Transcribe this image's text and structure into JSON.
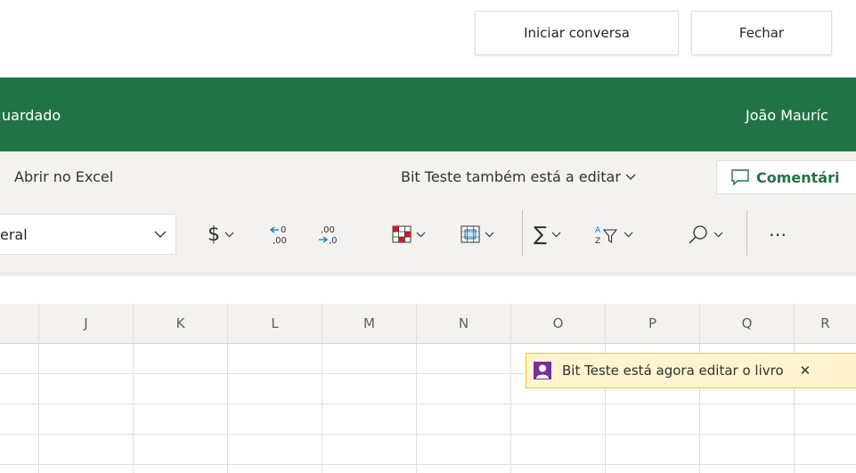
{
  "top_buttons": {
    "start": "Iniciar conversa",
    "close": "Fechar"
  },
  "titlebar": {
    "doc_status": "uardado",
    "user": "João Mauríc"
  },
  "ribbon": {
    "open_in_excel": "Abrir no Excel",
    "coauthor_status": "Bit Teste também está a editar",
    "comments": "Comentári"
  },
  "number_format": {
    "value": "eral"
  },
  "toolbar_icons": [
    "dollar-icon",
    "decrease-decimal-icon",
    "increase-decimal-icon",
    "fill-color-icon",
    "borders-icon",
    "autosum-icon",
    "sort-filter-icon",
    "find-icon",
    "more-icon"
  ],
  "columns": [
    "J",
    "K",
    "L",
    "M",
    "N",
    "O",
    "P",
    "Q",
    "R"
  ],
  "notice": {
    "text": "Bit Teste está agora editar o livro"
  },
  "colors": {
    "brand": "#217346",
    "notice_bg": "#fff4ce",
    "notice_border": "#f2c811",
    "avatar": "#7a2f9c"
  }
}
